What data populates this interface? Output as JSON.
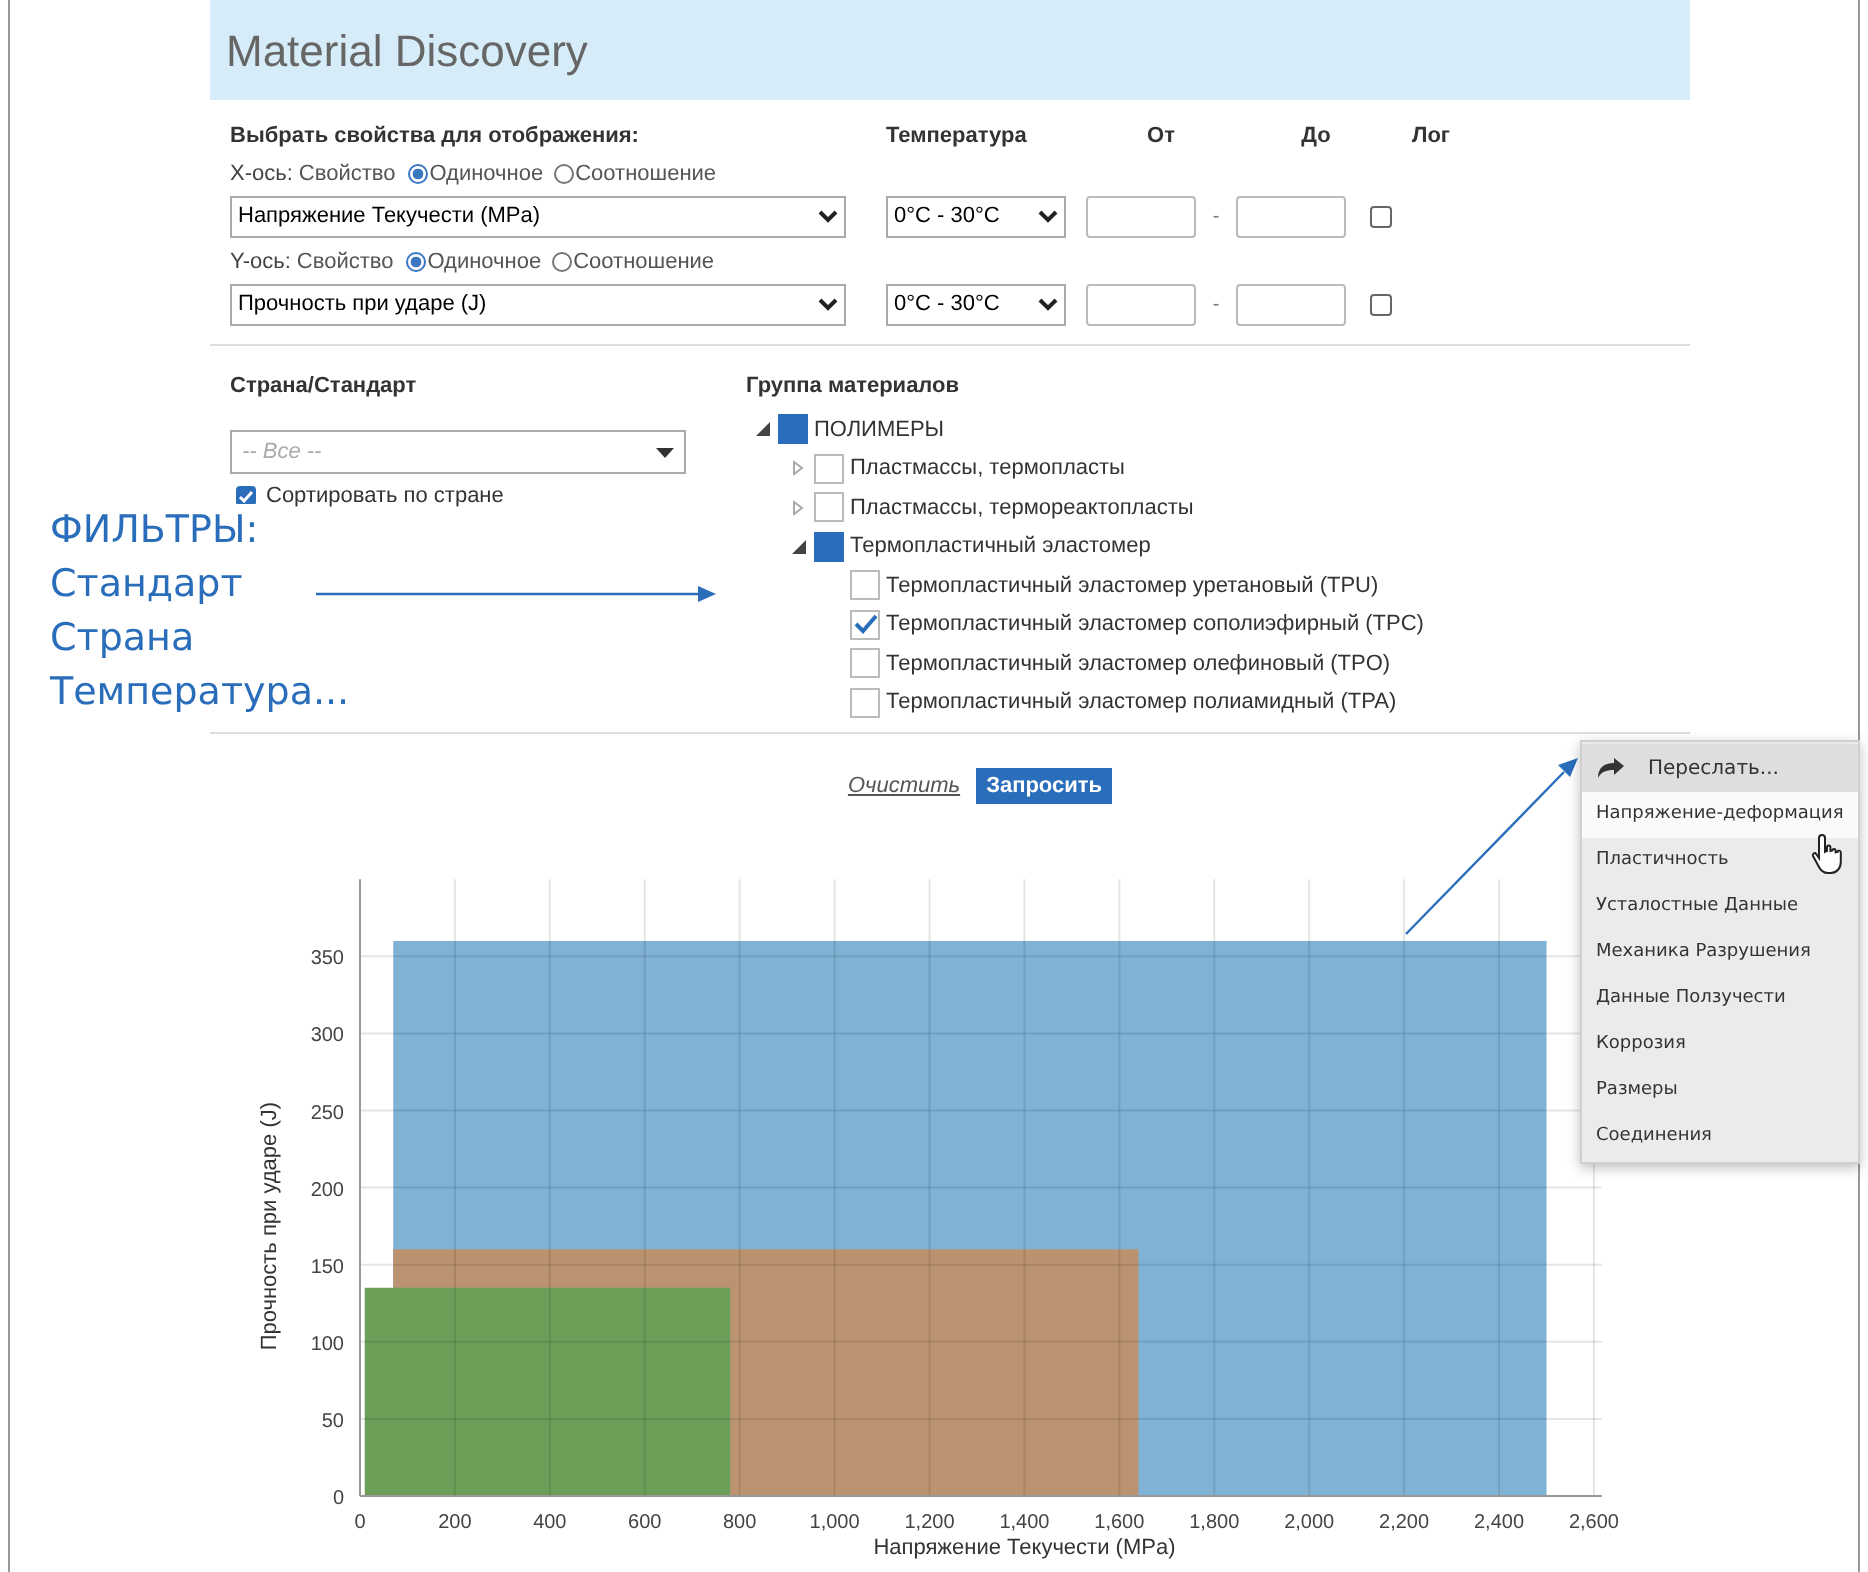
{
  "header": {
    "title": "Material Discovery"
  },
  "properties": {
    "heading": "Выбрать свойства для отображения:",
    "columns": [
      "Температура",
      "От",
      "До",
      "Лог"
    ],
    "axes": [
      {
        "label": "X-ось:",
        "prop": "Свойство",
        "options": [
          {
            "label": "Одиночное",
            "selected": true
          },
          {
            "label": "Соотношение",
            "selected": false
          }
        ],
        "value": "Напряжение Текучести (MPa)",
        "temperature": "0°C - 30°C",
        "dash": "-",
        "log": false
      },
      {
        "label": "Y-ось:",
        "prop": "Свойство",
        "options": [
          {
            "label": "Одиночное",
            "selected": true
          },
          {
            "label": "Соотношение",
            "selected": false
          }
        ],
        "value": "Прочность при ударе (J)",
        "temperature": "0°C - 30°C",
        "dash": "-",
        "log": false
      }
    ]
  },
  "country": {
    "heading": "Страна/Стандарт",
    "placeholder": "-- Все --",
    "sort_label": "Сортировать по стране",
    "sort": true
  },
  "materials": {
    "heading": "Группа материалов",
    "tree": [
      {
        "label": "ПОЛИМЕРЫ",
        "expanded": true,
        "checked": false,
        "partial": true,
        "children": [
          {
            "label": "Пластмассы, термопласты",
            "expanded": false,
            "checked": false,
            "partial": false
          },
          {
            "label": "Пластмассы, термореактопласты",
            "expanded": false,
            "checked": false,
            "partial": false
          },
          {
            "label": "Термопластичный эластомер",
            "expanded": true,
            "checked": false,
            "partial": true,
            "children": [
              {
                "label": "Термопластичный эластомер уретановый (TPU)",
                "checked": false
              },
              {
                "label": "Термопластичный эластомер сополиэфирный (TPC)",
                "checked": true
              },
              {
                "label": "Термопластичный эластомер олефиновый (TPO)",
                "checked": false
              },
              {
                "label": "Термопластичный эластомер полиамидный (TPA)",
                "checked": false
              }
            ]
          }
        ]
      }
    ]
  },
  "annotation": {
    "lines": [
      "ФИЛЬТРЫ:",
      "Стандарт",
      "Страна",
      "Температура..."
    ]
  },
  "actions": {
    "clear": "Очистить",
    "submit": "Запросить"
  },
  "menu": [
    {
      "kind": "header",
      "label": "Переслать...",
      "selected": false
    },
    {
      "kind": "item",
      "label": "Напряжение-деформация",
      "selected": true
    },
    {
      "kind": "item",
      "label": "Пластичность",
      "selected": false
    },
    {
      "kind": "item",
      "label": "Усталостные Данные",
      "selected": false
    },
    {
      "kind": "item",
      "label": "Механика Разрушения",
      "selected": false
    },
    {
      "kind": "item",
      "label": "Данные Ползучести",
      "selected": false
    },
    {
      "kind": "item",
      "label": "Коррозия",
      "selected": false
    },
    {
      "kind": "item",
      "label": "Размеры",
      "selected": false
    },
    {
      "kind": "item",
      "label": "Соединения",
      "selected": false
    }
  ],
  "chart": {
    "chart_data": {
      "type": "area",
      "grid": true,
      "xlim": [
        0,
        2600
      ],
      "ylim": [
        0,
        400
      ],
      "x": [
        10,
        70,
        780,
        1640,
        2500
      ],
      "xlabel": "Напряжение Текучести (MPa)",
      "ylabel": "Прочность при ударе (J)",
      "xticks": [
        {
          "value": 0,
          "label": "0"
        },
        {
          "value": 200,
          "label": "200"
        },
        {
          "value": 400,
          "label": "400"
        },
        {
          "value": 600,
          "label": "600"
        },
        {
          "value": 800,
          "label": "800"
        },
        {
          "value": 1000,
          "label": "1,000"
        },
        {
          "value": 1200,
          "label": "1,200"
        },
        {
          "value": 1400,
          "label": "1,400"
        },
        {
          "value": 1600,
          "label": "1,600"
        },
        {
          "value": 1800,
          "label": "1,800"
        },
        {
          "value": 2000,
          "label": "2,000"
        },
        {
          "value": 2200,
          "label": "2,200"
        },
        {
          "value": 2400,
          "label": "2,400"
        },
        {
          "value": 2600,
          "label": "2,600"
        }
      ],
      "yticks": [
        0,
        50,
        100,
        150,
        200,
        250,
        300,
        350
      ],
      "series": [
        {
          "color": "#7fb2d4",
          "values": [
            null,
            360,
            360,
            360,
            360
          ]
        },
        {
          "color": "#bb9370",
          "values": [
            null,
            160,
            160,
            160,
            null
          ]
        },
        {
          "color": "#6b9f58",
          "values": [
            135,
            135,
            135,
            null,
            null
          ]
        }
      ]
    }
  }
}
